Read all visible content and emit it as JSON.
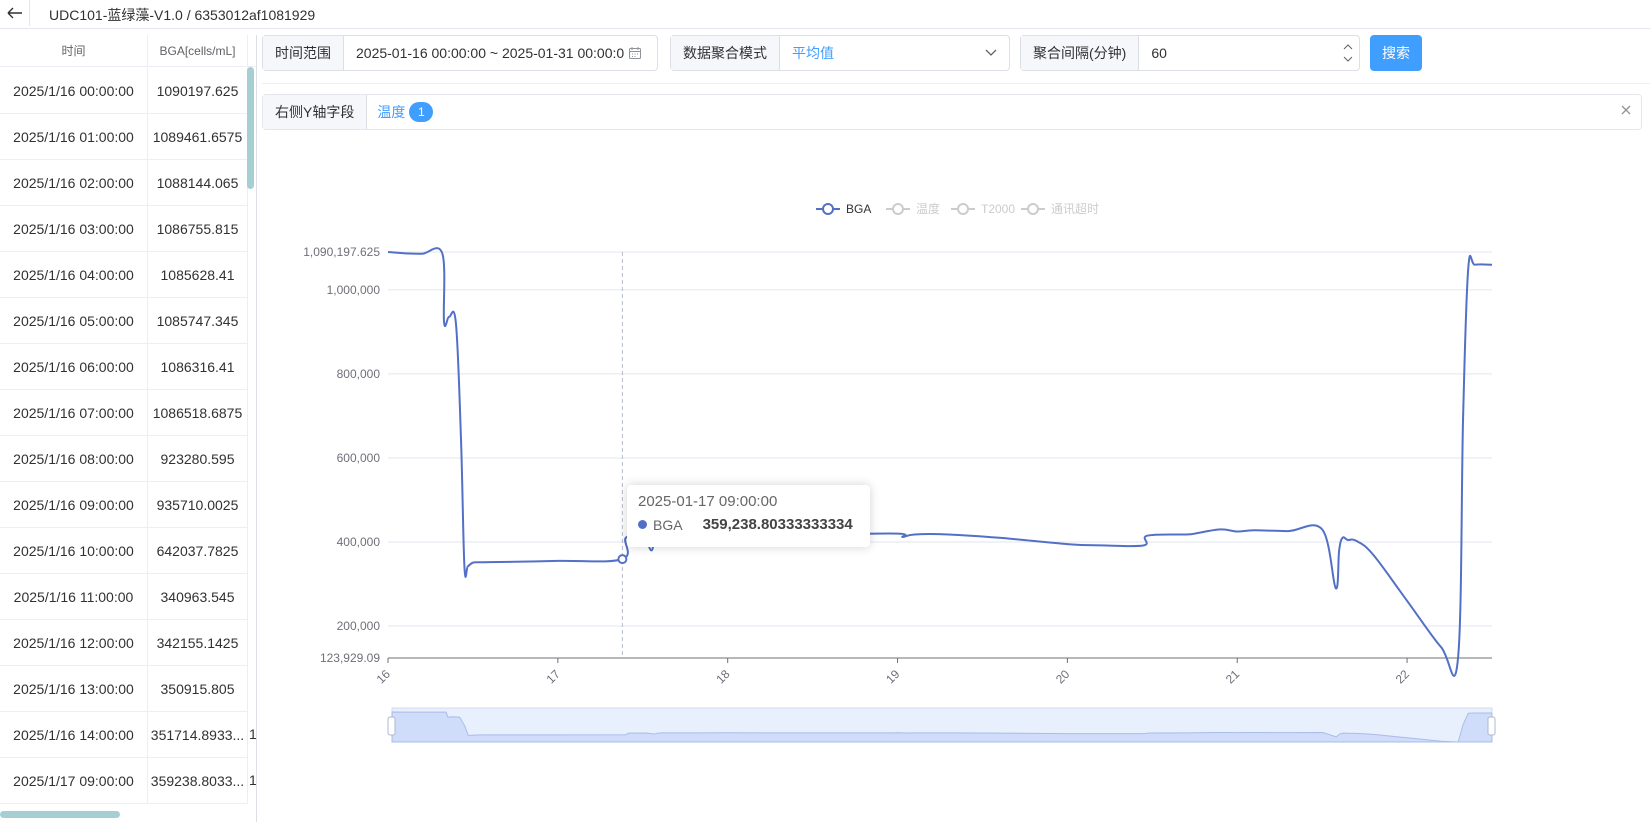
{
  "header": {
    "breadcrumb": "UDC101-蓝绿藻-V1.0 / 6353012af1081929"
  },
  "table": {
    "columns": [
      "时间",
      "BGA[cells/mL]"
    ],
    "rows": [
      {
        "time": "2025/1/16 00:00:00",
        "bga": "1090197.625"
      },
      {
        "time": "2025/1/16 01:00:00",
        "bga": "1089461.6575"
      },
      {
        "time": "2025/1/16 02:00:00",
        "bga": "1088144.065"
      },
      {
        "time": "2025/1/16 03:00:00",
        "bga": "1086755.815"
      },
      {
        "time": "2025/1/16 04:00:00",
        "bga": "1085628.41"
      },
      {
        "time": "2025/1/16 05:00:00",
        "bga": "1085747.345"
      },
      {
        "time": "2025/1/16 06:00:00",
        "bga": "1086316.41"
      },
      {
        "time": "2025/1/16 07:00:00",
        "bga": "1086518.6875"
      },
      {
        "time": "2025/1/16 08:00:00",
        "bga": "923280.595"
      },
      {
        "time": "2025/1/16 09:00:00",
        "bga": "935710.0025"
      },
      {
        "time": "2025/1/16 10:00:00",
        "bga": "642037.7825"
      },
      {
        "time": "2025/1/16 11:00:00",
        "bga": "340963.545"
      },
      {
        "time": "2025/1/16 12:00:00",
        "bga": "342155.1425"
      },
      {
        "time": "2025/1/16 13:00:00",
        "bga": "350915.805"
      },
      {
        "time": "2025/1/16 14:00:00",
        "bga": "351714.8933..."
      },
      {
        "time": "2025/1/17 09:00:00",
        "bga": "359238.8033..."
      }
    ],
    "overflow_char": "1"
  },
  "filters": {
    "time_range_label": "时间范围",
    "time_range_value": "2025-01-16 00:00:00 ~ 2025-01-31 00:00:0",
    "agg_mode_label": "数据聚合模式",
    "agg_mode_value": "平均值",
    "interval_label": "聚合间隔(分钟)",
    "interval_value": "60",
    "search_label": "搜索"
  },
  "right_axis": {
    "label": "右侧Y轴字段",
    "tag": "温度",
    "count": "1"
  },
  "tooltip": {
    "title": "2025-01-17 09:00:00",
    "series": "BGA",
    "value": "359,238.80333333334"
  },
  "colors": {
    "primary": "#409eff",
    "series": "#5470c6",
    "legend_off": "#cccccc"
  },
  "chart_data": {
    "type": "line",
    "legend": [
      {
        "name": "BGA",
        "active": true
      },
      {
        "name": "温度",
        "active": false
      },
      {
        "name": "T2000",
        "active": false
      },
      {
        "name": "通讯超时",
        "active": false
      }
    ],
    "x_ticks": [
      "16",
      "17",
      "18",
      "19",
      "20",
      "21",
      "22"
    ],
    "xlim": [
      16,
      22.5
    ],
    "ylim": [
      123929.09,
      1090197.625
    ],
    "y_ticks": [
      "1,090,197.625",
      "1,000,000",
      "800,000",
      "600,000",
      "400,000",
      "200,000",
      "123,929.09"
    ],
    "y_tick_values": [
      1090197.625,
      1000000,
      800000,
      600000,
      400000,
      200000,
      123929.09
    ],
    "x": [
      16,
      16.1,
      16.2,
      16.32,
      16.33,
      16.36,
      16.4,
      16.43,
      16.45,
      16.47,
      16.5,
      16.55,
      16.6,
      17,
      17.38,
      17.4,
      17.5,
      17.55,
      17.57,
      17.6,
      17.8,
      18,
      18.5,
      19,
      19.03,
      19.1,
      19.3,
      19.6,
      20,
      20.2,
      20.45,
      20.47,
      20.7,
      20.75,
      20.9,
      21,
      21.1,
      21.3,
      21.5,
      21.58,
      21.6,
      21.62,
      21.65,
      21.7,
      21.8,
      22,
      22.2,
      22.3,
      22.33,
      22.36,
      22.4,
      22.5
    ],
    "y": [
      1090197,
      1087000,
      1086000,
      1086500,
      923280,
      935710,
      920000,
      642037,
      340963,
      342155,
      350915,
      351714,
      352000,
      355000,
      359238,
      410000,
      415000,
      380000,
      410000,
      418000,
      418000,
      420000,
      418000,
      420000,
      412000,
      418000,
      418000,
      410000,
      395000,
      392000,
      392000,
      415000,
      418000,
      420000,
      430000,
      425000,
      428000,
      426000,
      430000,
      290000,
      380000,
      410000,
      405000,
      403000,
      370000,
      260000,
      150000,
      123929,
      700000,
      1050000,
      1060000,
      1060000
    ]
  }
}
